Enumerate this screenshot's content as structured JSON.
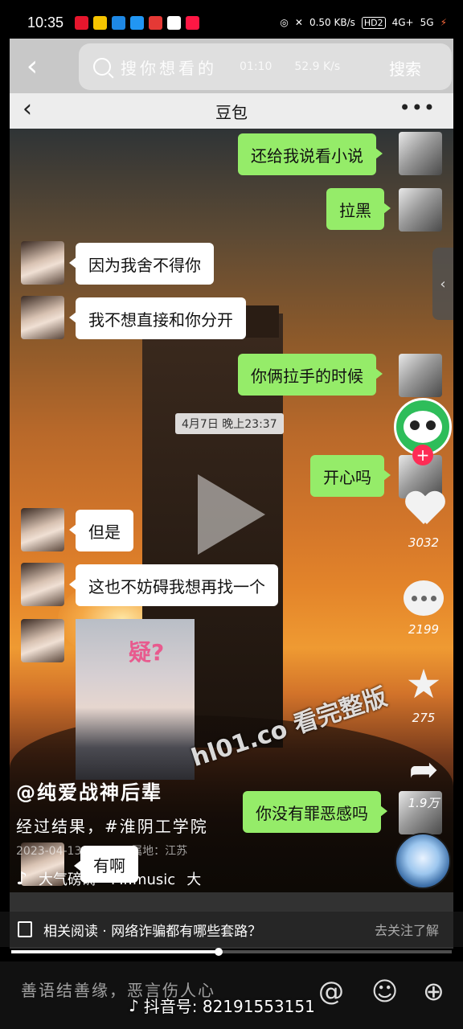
{
  "statusbar": {
    "time": "10:35",
    "net_speed": "0.50 KB/s",
    "hd": "HD2",
    "signal1": "4G+",
    "signal2": "5G"
  },
  "search": {
    "placeholder": "搜你想看的",
    "ghost_time": "01:10",
    "ghost_speed": "52.9 K/s",
    "button": "搜索"
  },
  "chat": {
    "title": "豆包",
    "more": "•••",
    "messages": [
      {
        "from": "me",
        "text": "还给我说看小说"
      },
      {
        "from": "me",
        "text": "拉黑"
      },
      {
        "from": "her",
        "text": "因为我舍不得你"
      },
      {
        "from": "her",
        "text": "我不想直接和你分开"
      },
      {
        "from": "me",
        "text": "你俩拉手的时候"
      },
      {
        "from": "me",
        "text": "开心吗"
      },
      {
        "from": "her",
        "text": "但是"
      },
      {
        "from": "her",
        "text": "这也不妨碍我想再找一个"
      },
      {
        "from": "me",
        "text": "你没有罪恶感吗"
      },
      {
        "from": "her",
        "text": "有啊"
      }
    ],
    "timestamp": "4月7日 晚上23:37",
    "photo_text": "疑?"
  },
  "video": {
    "author": "@纯爱战神后辈",
    "description": "经过结果，#淮阴工学院",
    "meta": "2023-04-13 13:4 · IP属地：江苏",
    "music": "大气磅礴 - Mr.music",
    "music_tail": "大",
    "watermark": "hl01.co 看完整版",
    "likes": "3032",
    "comments": "2199",
    "favorites": "275",
    "shares": "1.9万",
    "progress": 0.47
  },
  "related": {
    "label": "相关阅读 · 网络诈骗都有哪些套路？",
    "action": "去关注了解"
  },
  "comment_bar": {
    "placeholder": "善语结善缘，恶言伤人心",
    "douyin_id": "抖音号: 82191553151"
  },
  "colors": {
    "wechat_green": "#95ec69",
    "follow_red": "#fe2c55"
  }
}
